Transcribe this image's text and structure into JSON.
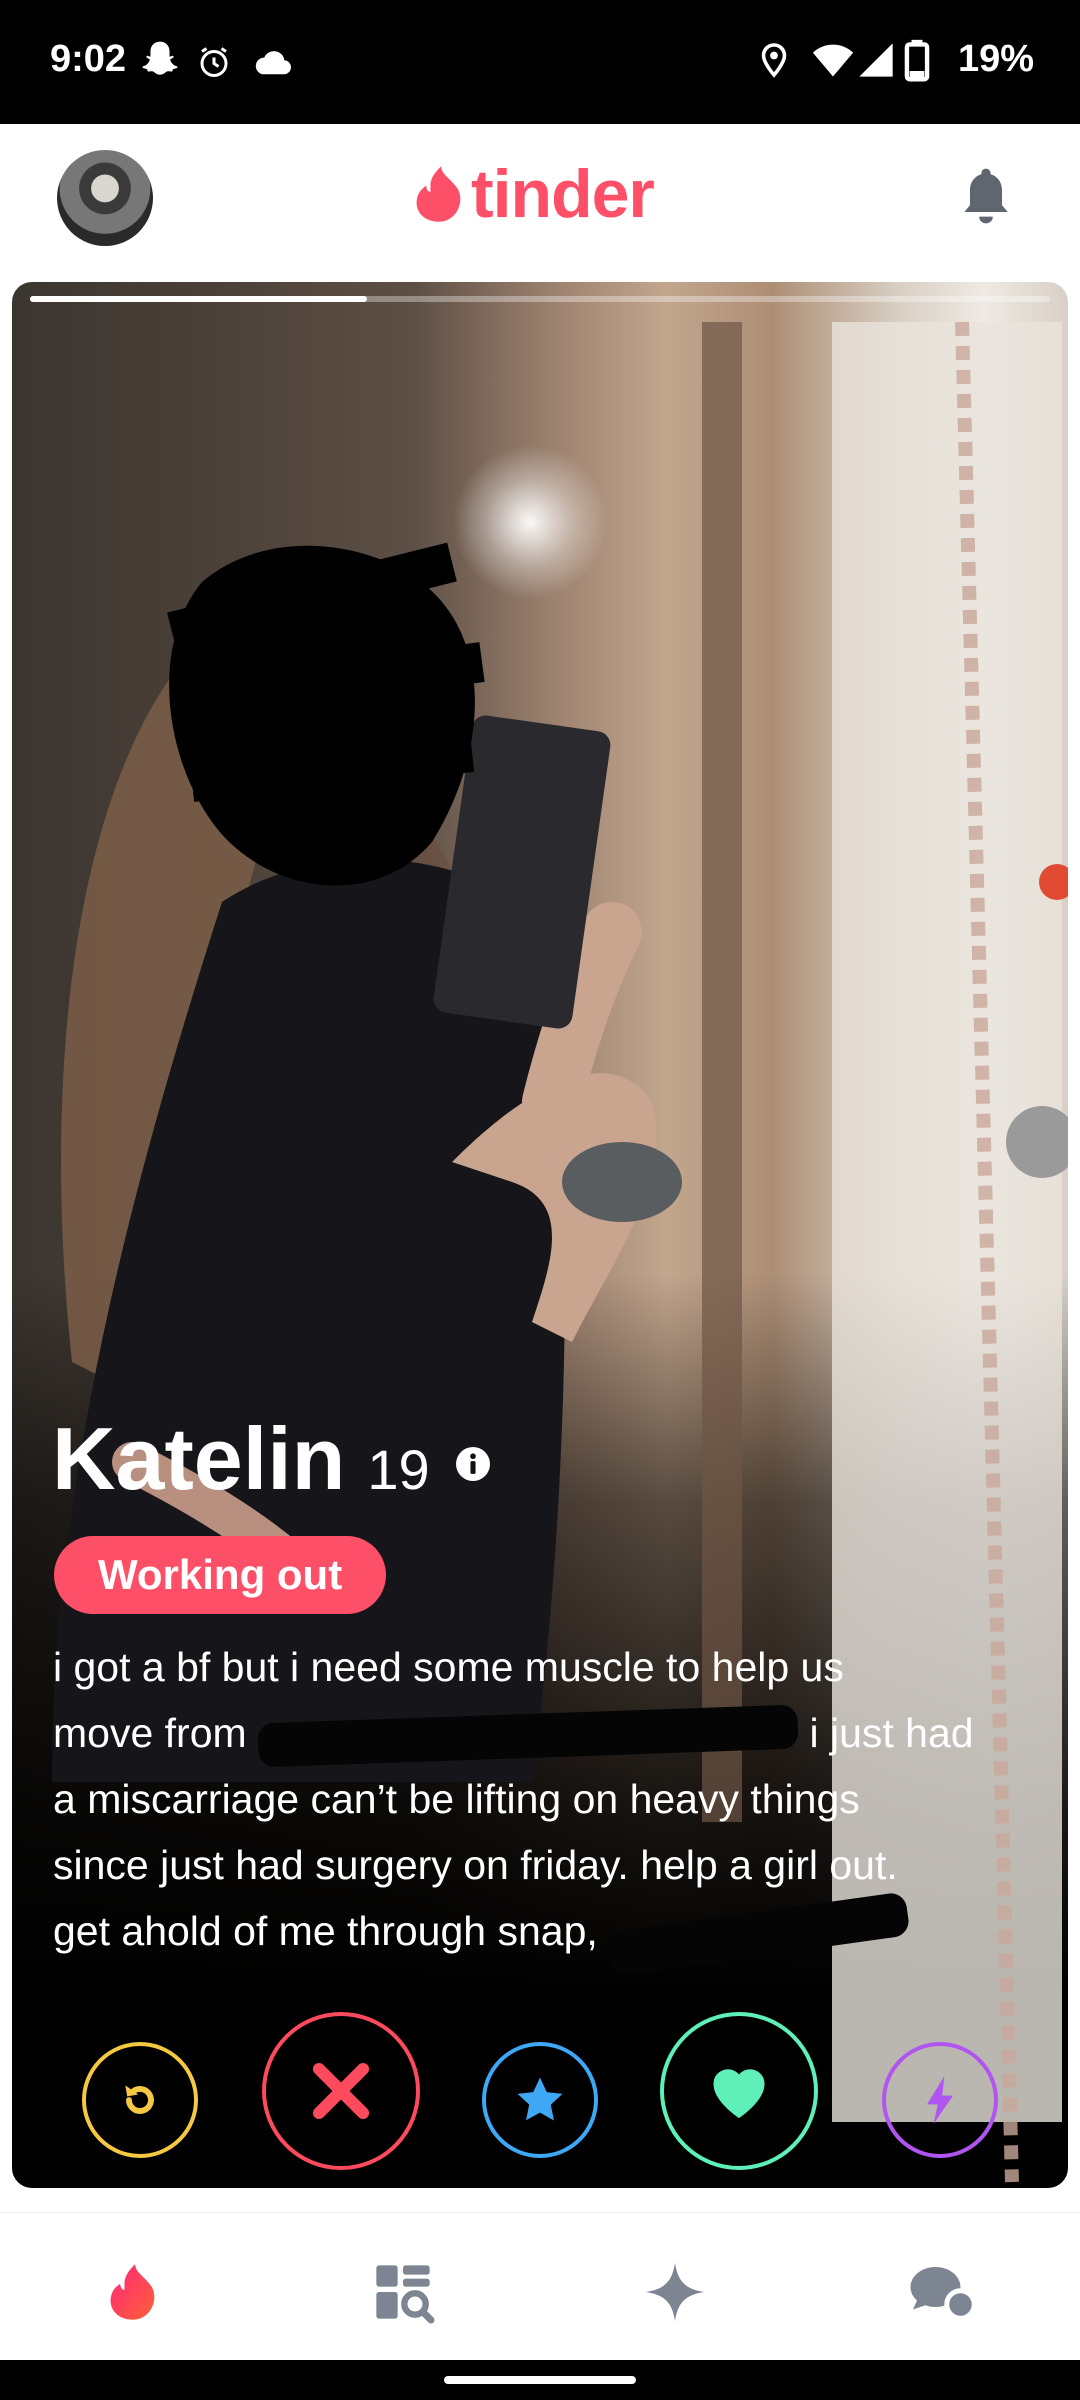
{
  "status_bar": {
    "time": "9:02",
    "battery": "19%",
    "icons": [
      "snapchat-icon",
      "alarm-icon",
      "cloud-icon",
      "location-icon",
      "wifi-icon",
      "signal-icon",
      "battery-icon"
    ]
  },
  "header": {
    "logo_text": "tinder",
    "brand_color": "#fd5068",
    "left_icon": "profile-avatar",
    "right_icon": "bell-icon"
  },
  "card": {
    "photo_progress": 0.33,
    "name": "Katelin",
    "age": "19",
    "interest": "Working out",
    "bio_lines": [
      {
        "before": "i got a bf but i need some muscle to help us",
        "after": ""
      },
      {
        "before": "move from",
        "after": "i just had"
      },
      {
        "before": "a miscarriage can’t be lifting on heavy things",
        "after": ""
      },
      {
        "before": "since just had surgery on friday. help a girl out.",
        "after": ""
      },
      {
        "before": "get ahold of me through snap,",
        "after": ""
      }
    ]
  },
  "actions": [
    {
      "name": "rewind",
      "icon": "rewind-icon",
      "color": "#f5c842"
    },
    {
      "name": "nope",
      "icon": "x-icon",
      "color": "#fd4a5c"
    },
    {
      "name": "super-like",
      "icon": "star-icon",
      "color": "#3ea8f5"
    },
    {
      "name": "like",
      "icon": "heart-icon",
      "color": "#5ef0b8"
    },
    {
      "name": "boost",
      "icon": "lightning-icon",
      "color": "#b055f0"
    }
  ],
  "bottom_nav": [
    {
      "name": "swipe",
      "icon": "flame-icon",
      "active": true
    },
    {
      "name": "explore",
      "icon": "explore-icon",
      "active": false
    },
    {
      "name": "likes",
      "icon": "sparkle-icon",
      "active": false
    },
    {
      "name": "chats",
      "icon": "chat-icon",
      "active": false
    }
  ]
}
